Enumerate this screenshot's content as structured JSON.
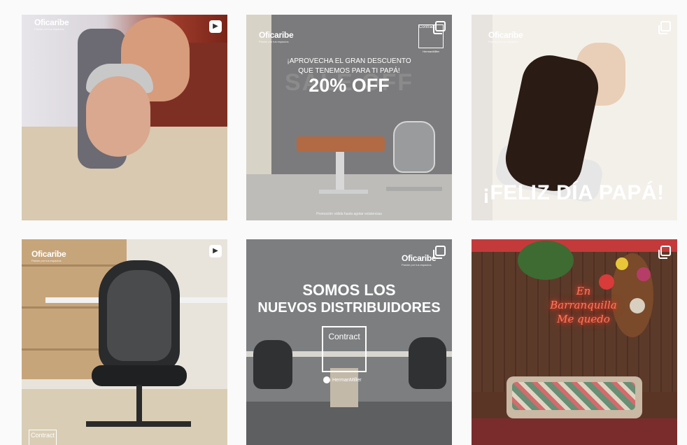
{
  "posts": [
    {
      "type": "reel",
      "type_icon": "reel-icon",
      "logo": "Oficaribe",
      "logo_tag": "Pasión por tus espacios"
    },
    {
      "type": "carousel",
      "type_icon": "carousel-icon",
      "logo": "Oficaribe",
      "logo_tag": "Pasión por tus espacios",
      "promo_line1": "¡APROVECHA EL GRAN DESCUENTO",
      "promo_line2": "QUE TENEMOS PARA TI PAPÁ!",
      "ghost_text": "SALE OFF",
      "promo_big": "20% OFF",
      "disclaimer": "Promoción válida hasta agotar existencias",
      "contract_label": "Contract",
      "brand": "HermanMiller"
    },
    {
      "type": "carousel",
      "type_icon": "carousel-icon",
      "logo": "Oficaribe",
      "logo_tag": "Pasión por tus espacios",
      "headline": "¡FELIZ DÍA PAPÁ!"
    },
    {
      "type": "reel",
      "type_icon": "reel-icon",
      "logo": "Oficaribe",
      "logo_tag": "Pasión por tus espacios",
      "contract_label": "Contract"
    },
    {
      "type": "carousel",
      "type_icon": "carousel-icon",
      "logo": "Oficaribe",
      "logo_tag": "Pasión por tus espacios",
      "headline_line1": "SOMOS LOS",
      "headline_line2": "NUEVOS DISTRIBUIDORES",
      "contract_label": "Contract",
      "brand": "HermanMiller"
    },
    {
      "type": "carousel",
      "type_icon": "carousel-icon",
      "neon_line1": "En",
      "neon_line2": "Barranquilla",
      "neon_line3": "Me quedo"
    }
  ],
  "colors": {
    "background": "#fafafa",
    "neon": "#ff7a5a"
  }
}
